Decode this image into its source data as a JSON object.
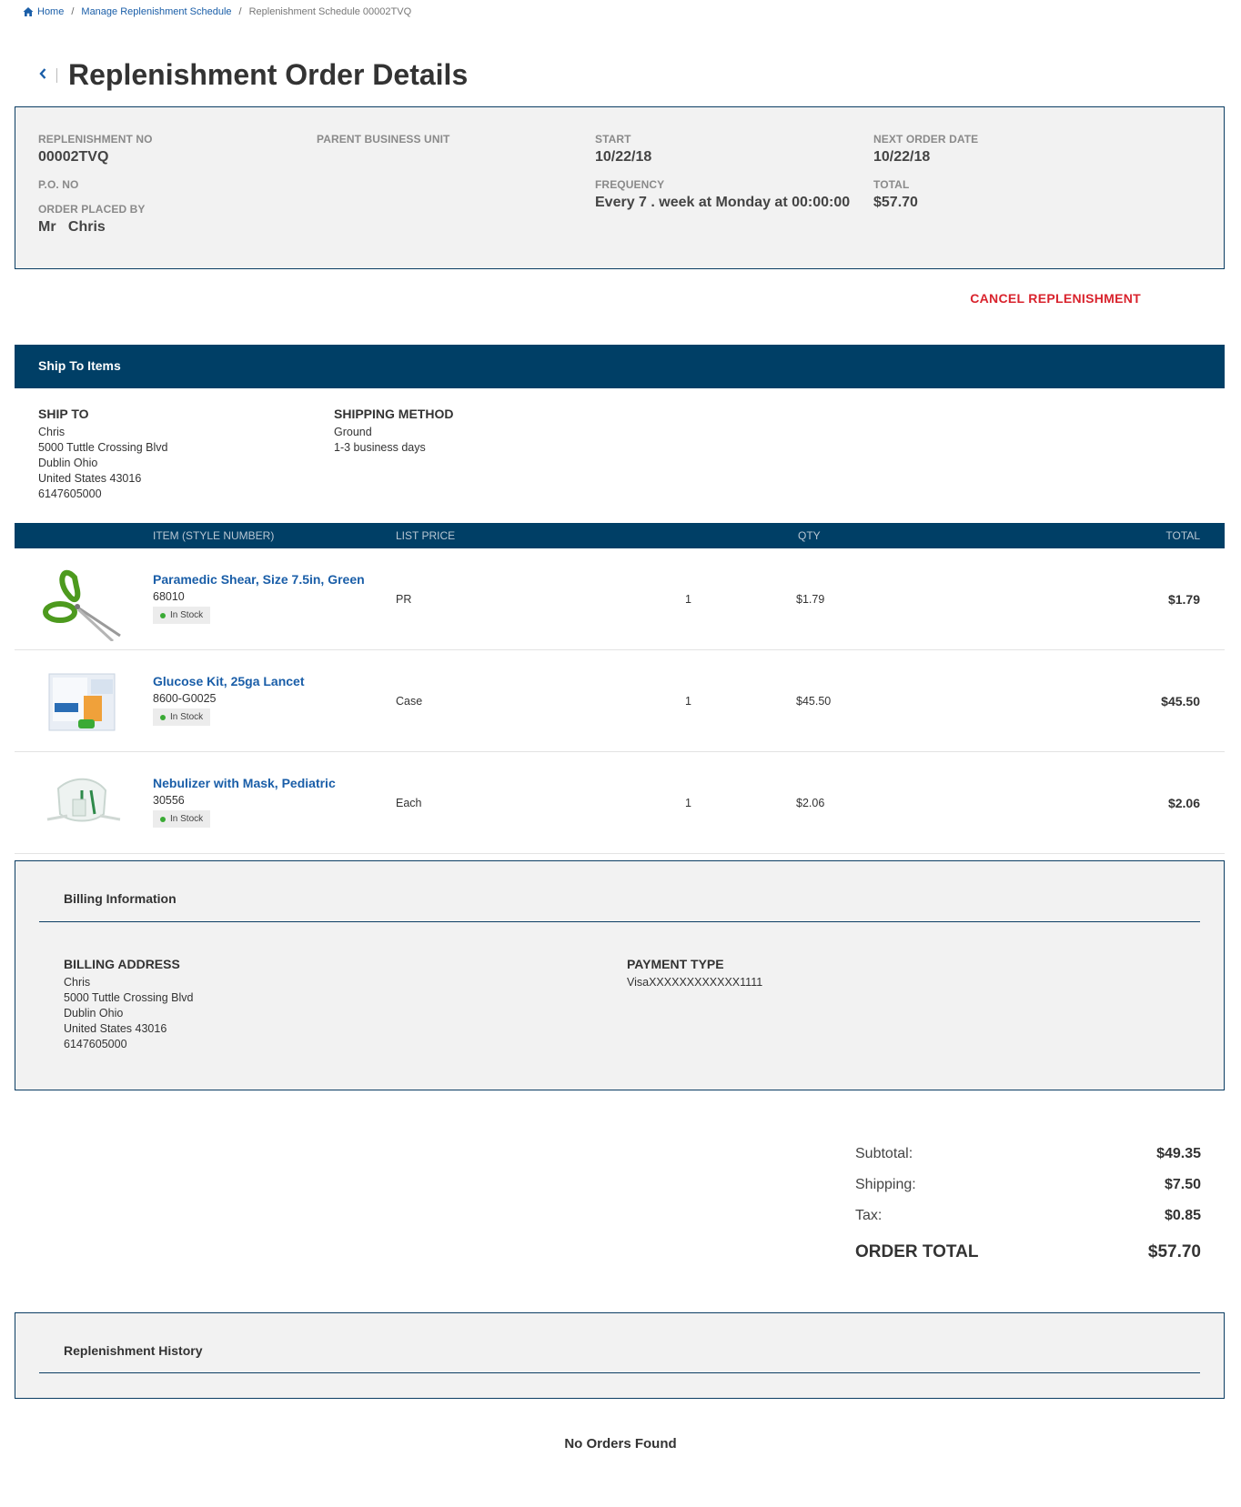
{
  "breadcrumb": {
    "home": "Home",
    "manage": "Manage Replenishment Schedule",
    "current": "Replenishment Schedule 00002TVQ"
  },
  "page": {
    "title": "Replenishment Order Details",
    "back_icon": "chevron-left-icon"
  },
  "summary": {
    "replenishment_no_label": "REPLENISHMENT NO",
    "replenishment_no": "00002TVQ",
    "po_no_label": "P.O. NO",
    "order_placed_by_label": "ORDER PLACED BY",
    "order_placed_by": "Mr   Chris",
    "parent_bu_label": "PARENT BUSINESS UNIT",
    "start_label": "START",
    "start": "10/22/18",
    "frequency_label": "FREQUENCY",
    "frequency": "Every 7 . week at Monday at 00:00:00",
    "next_order_label": "NEXT ORDER DATE",
    "next_order": "10/22/18",
    "total_label": "TOTAL",
    "total": "$57.70"
  },
  "cancel_label": "CANCEL REPLENISHMENT",
  "ship": {
    "header": "Ship To Items",
    "ship_to_label": "SHIP TO",
    "name": "Chris",
    "line1": "5000 Tuttle Crossing Blvd",
    "line2": "Dublin Ohio",
    "line3": "United States 43016",
    "phone": "6147605000",
    "method_label": "SHIPPING METHOD",
    "method": "Ground",
    "method_detail": "1-3 business days"
  },
  "items_table": {
    "columns": {
      "item": "ITEM (STYLE NUMBER)",
      "list_price": "LIST PRICE",
      "qty": "QTY",
      "total": "TOTAL"
    },
    "rows": [
      {
        "name": "Paramedic Shear, Size 7.5in, Green",
        "sku": "68010",
        "stock": "In Stock",
        "uom": "PR",
        "qty": "1",
        "price": "$1.79",
        "total": "$1.79"
      },
      {
        "name": "Glucose Kit, 25ga Lancet",
        "sku": "8600-G0025",
        "stock": "In Stock",
        "uom": "Case",
        "qty": "1",
        "price": "$45.50",
        "total": "$45.50"
      },
      {
        "name": "Nebulizer with Mask, Pediatric",
        "sku": "30556",
        "stock": "In Stock",
        "uom": "Each",
        "qty": "1",
        "price": "$2.06",
        "total": "$2.06"
      }
    ]
  },
  "billing": {
    "title": "Billing Information",
    "address_label": "BILLING ADDRESS",
    "name": "Chris",
    "line1": "5000 Tuttle Crossing Blvd",
    "line2": "Dublin Ohio",
    "line3": "United States 43016",
    "phone": "6147605000",
    "payment_label": "PAYMENT TYPE",
    "payment": "VisaXXXXXXXXXXXX1111"
  },
  "totals": {
    "subtotal_label": "Subtotal:",
    "subtotal": "$49.35",
    "shipping_label": "Shipping:",
    "shipping": "$7.50",
    "tax_label": "Tax:",
    "tax": "$0.85",
    "order_total_label": "ORDER TOTAL",
    "order_total": "$57.70"
  },
  "history": {
    "title": "Replenishment History",
    "empty": "No Orders Found"
  },
  "colors": {
    "navy": "#003f66",
    "link": "#1a5ea8",
    "cancel": "#d9232d",
    "panel": "#f2f2f2"
  }
}
